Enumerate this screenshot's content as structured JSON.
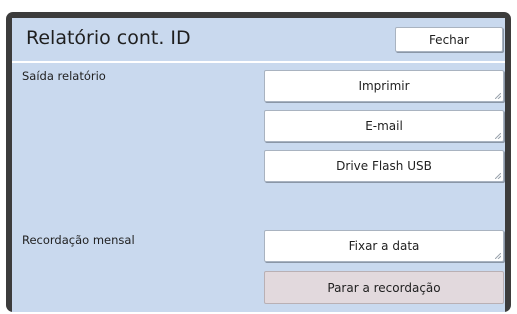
{
  "header": {
    "title": "Relatório cont. ID",
    "close_label": "Fechar"
  },
  "report_output": {
    "label": "Saída relatório",
    "print_label": "Imprimir",
    "email_label": "E-mail",
    "usb_label": "Drive Flash USB"
  },
  "monthly_record": {
    "label": "Recordação mensal",
    "set_date_label": "Fixar a data",
    "stop_record_label": "Parar a recordação"
  },
  "colors": {
    "panel_background": "#c9d9ee",
    "frame": "#3c3c3c",
    "disabled_button": "#e2d9dd"
  }
}
